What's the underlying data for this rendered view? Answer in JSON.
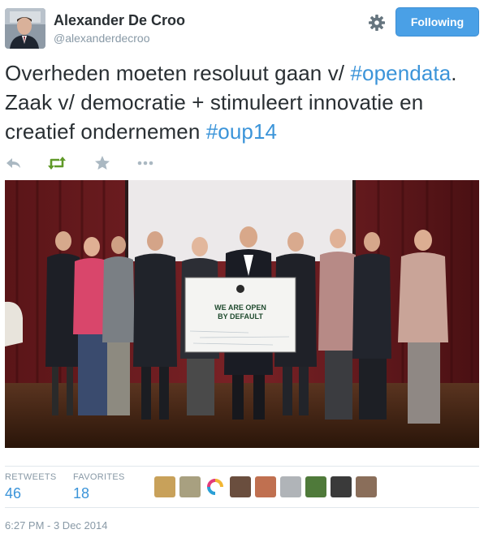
{
  "user": {
    "name": "Alexander De Croo",
    "handle": "@alexanderdecroo"
  },
  "follow_button": {
    "label": "Following"
  },
  "tweet": {
    "segments": [
      {
        "text": "Overheden moeten resoluut gaan v/ ",
        "type": "text"
      },
      {
        "text": "#opendata",
        "type": "hashtag"
      },
      {
        "text": ". Zaak v/ democratie + stimuleert innovatie en creatief ondernemen ",
        "type": "text"
      },
      {
        "text": "#oup14",
        "type": "hashtag"
      }
    ]
  },
  "actions": [
    {
      "icon": "reply-icon"
    },
    {
      "icon": "retweet-icon",
      "color": "#609928"
    },
    {
      "icon": "favorite-icon"
    },
    {
      "icon": "more-icon"
    }
  ],
  "photo": {
    "sign_line1": "WE ARE OPEN",
    "sign_line2": "BY DEFAULT"
  },
  "stats": {
    "retweets_label": "RETWEETS",
    "retweets_value": "46",
    "favorites_label": "FAVORITES",
    "favorites_value": "18"
  },
  "timestamp": "6:27 PM - 3 Dec 2014",
  "colors": {
    "accent": "#3b94d9",
    "button": "#4aa0e6",
    "muted": "#8899a6"
  }
}
